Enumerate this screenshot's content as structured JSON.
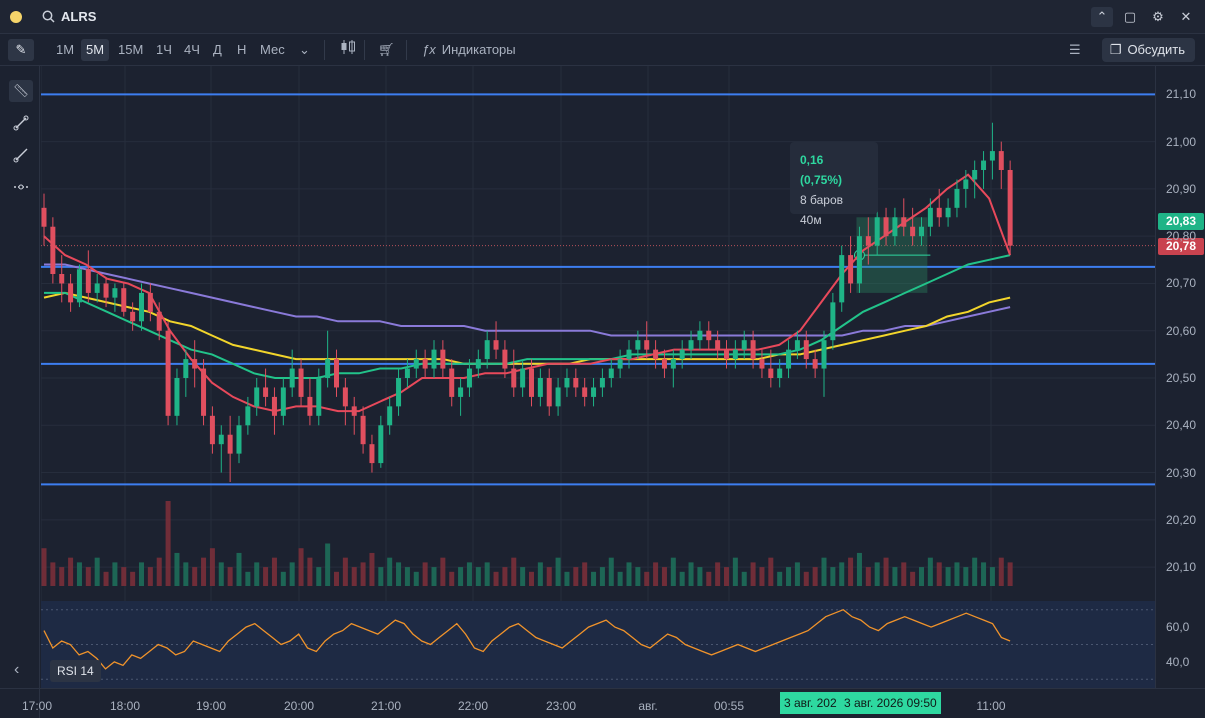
{
  "ticker": "ALRS",
  "timeframes": [
    "1М",
    "5М",
    "15М",
    "1Ч",
    "4Ч",
    "Д",
    "Н",
    "Мес"
  ],
  "active_timeframe": "5М",
  "indicators_label": "Индикаторы",
  "discuss_label": "Обсудить",
  "price_labels": [
    "21,10",
    "21,00",
    "20,90",
    "20,80",
    "20,70",
    "20,60",
    "20,50",
    "20,40",
    "20,30",
    "20,20",
    "20,10"
  ],
  "last_price_badge": "20,83",
  "current_price_badge": "20,78",
  "rsi_labels": [
    "60,0",
    "40,0"
  ],
  "rsi_name": "RSI 14",
  "time_labels": [
    "17:00",
    "18:00",
    "19:00",
    "20:00",
    "21:00",
    "22:00",
    "23:00",
    "авг.",
    "00:55",
    "11:00"
  ],
  "cursor_time_1": "3 авг. 202",
  "cursor_time_2": "3 авг. 2026 09:50",
  "measure": {
    "change": "0,16 (0,75%)",
    "bars": "8 баров",
    "duration": "40м",
    "marker": "B"
  },
  "colors": {
    "bg": "#1c2230",
    "up": "#1fb487",
    "down": "#e04f5f",
    "level": "#3d7ef0",
    "ema_fast": "#e8495b",
    "ema_mid": "#22c38a",
    "ema_slow": "#f2d52b",
    "ema_long": "#8a7ad9",
    "rsi": "#f0932b"
  },
  "chart_data": {
    "type": "candlestick",
    "y_range": [
      20.06,
      21.16
    ],
    "levels": [
      21.1,
      20.735,
      20.53,
      20.275
    ],
    "candles": [
      [
        20.86,
        20.89,
        20.78,
        20.82
      ],
      [
        20.82,
        20.84,
        20.7,
        20.72
      ],
      [
        20.72,
        20.76,
        20.66,
        20.7
      ],
      [
        20.7,
        20.72,
        20.64,
        20.66
      ],
      [
        20.66,
        20.74,
        20.65,
        20.73
      ],
      [
        20.73,
        20.77,
        20.66,
        20.68
      ],
      [
        20.68,
        20.72,
        20.66,
        20.7
      ],
      [
        20.7,
        20.71,
        20.65,
        20.67
      ],
      [
        20.67,
        20.7,
        20.64,
        20.69
      ],
      [
        20.69,
        20.7,
        20.63,
        20.64
      ],
      [
        20.64,
        20.66,
        20.6,
        20.62
      ],
      [
        20.62,
        20.7,
        20.6,
        20.68
      ],
      [
        20.68,
        20.7,
        20.62,
        20.64
      ],
      [
        20.64,
        20.66,
        20.58,
        20.6
      ],
      [
        20.6,
        20.62,
        20.4,
        20.42
      ],
      [
        20.42,
        20.52,
        20.4,
        20.5
      ],
      [
        20.5,
        20.56,
        20.46,
        20.54
      ],
      [
        20.54,
        20.58,
        20.48,
        20.52
      ],
      [
        20.52,
        20.54,
        20.4,
        20.42
      ],
      [
        20.42,
        20.44,
        20.34,
        20.36
      ],
      [
        20.36,
        20.4,
        20.3,
        20.38
      ],
      [
        20.38,
        20.42,
        20.28,
        20.34
      ],
      [
        20.34,
        20.42,
        20.32,
        20.4
      ],
      [
        20.4,
        20.46,
        20.38,
        20.44
      ],
      [
        20.44,
        20.5,
        20.42,
        20.48
      ],
      [
        20.48,
        20.52,
        20.44,
        20.46
      ],
      [
        20.46,
        20.48,
        20.38,
        20.42
      ],
      [
        20.42,
        20.5,
        20.4,
        20.48
      ],
      [
        20.48,
        20.56,
        20.46,
        20.52
      ],
      [
        20.52,
        20.54,
        20.44,
        20.46
      ],
      [
        20.46,
        20.5,
        20.4,
        20.42
      ],
      [
        20.42,
        20.52,
        20.4,
        20.5
      ],
      [
        20.5,
        20.6,
        20.48,
        20.54
      ],
      [
        20.54,
        20.56,
        20.46,
        20.48
      ],
      [
        20.48,
        20.5,
        20.4,
        20.44
      ],
      [
        20.44,
        20.46,
        20.38,
        20.42
      ],
      [
        20.42,
        20.44,
        20.34,
        20.36
      ],
      [
        20.36,
        20.38,
        20.3,
        20.32
      ],
      [
        20.32,
        20.42,
        20.31,
        20.4
      ],
      [
        20.4,
        20.46,
        20.38,
        20.44
      ],
      [
        20.44,
        20.52,
        20.42,
        20.5
      ],
      [
        20.5,
        20.54,
        20.48,
        20.52
      ],
      [
        20.52,
        20.56,
        20.5,
        20.54
      ],
      [
        20.54,
        20.56,
        20.5,
        20.52
      ],
      [
        20.52,
        20.58,
        20.5,
        20.56
      ],
      [
        20.56,
        20.58,
        20.5,
        20.52
      ],
      [
        20.52,
        20.54,
        20.44,
        20.46
      ],
      [
        20.46,
        20.5,
        20.42,
        20.48
      ],
      [
        20.48,
        20.54,
        20.46,
        20.52
      ],
      [
        20.52,
        20.56,
        20.5,
        20.54
      ],
      [
        20.54,
        20.6,
        20.52,
        20.58
      ],
      [
        20.58,
        20.62,
        20.54,
        20.56
      ],
      [
        20.56,
        20.58,
        20.5,
        20.52
      ],
      [
        20.52,
        20.56,
        20.46,
        20.48
      ],
      [
        20.48,
        20.54,
        20.46,
        20.52
      ],
      [
        20.52,
        20.54,
        20.44,
        20.46
      ],
      [
        20.46,
        20.52,
        20.44,
        20.5
      ],
      [
        20.5,
        20.52,
        20.42,
        20.44
      ],
      [
        20.44,
        20.5,
        20.42,
        20.48
      ],
      [
        20.48,
        20.52,
        20.46,
        20.5
      ],
      [
        20.5,
        20.52,
        20.46,
        20.48
      ],
      [
        20.48,
        20.5,
        20.44,
        20.46
      ],
      [
        20.46,
        20.5,
        20.44,
        20.48
      ],
      [
        20.48,
        20.52,
        20.46,
        20.5
      ],
      [
        20.5,
        20.54,
        20.48,
        20.52
      ],
      [
        20.52,
        20.56,
        20.5,
        20.54
      ],
      [
        20.54,
        20.58,
        20.52,
        20.56
      ],
      [
        20.56,
        20.6,
        20.54,
        20.58
      ],
      [
        20.58,
        20.62,
        20.54,
        20.56
      ],
      [
        20.56,
        20.58,
        20.52,
        20.54
      ],
      [
        20.54,
        20.56,
        20.5,
        20.52
      ],
      [
        20.52,
        20.56,
        20.48,
        20.54
      ],
      [
        20.54,
        20.58,
        20.52,
        20.56
      ],
      [
        20.56,
        20.6,
        20.54,
        20.58
      ],
      [
        20.58,
        20.62,
        20.56,
        20.6
      ],
      [
        20.6,
        20.62,
        20.56,
        20.58
      ],
      [
        20.58,
        20.6,
        20.54,
        20.56
      ],
      [
        20.56,
        20.58,
        20.52,
        20.54
      ],
      [
        20.54,
        20.58,
        20.52,
        20.56
      ],
      [
        20.56,
        20.6,
        20.54,
        20.58
      ],
      [
        20.58,
        20.6,
        20.52,
        20.54
      ],
      [
        20.54,
        20.56,
        20.5,
        20.52
      ],
      [
        20.52,
        20.56,
        20.48,
        20.5
      ],
      [
        20.5,
        20.54,
        20.48,
        20.52
      ],
      [
        20.52,
        20.58,
        20.5,
        20.56
      ],
      [
        20.56,
        20.6,
        20.54,
        20.58
      ],
      [
        20.58,
        20.6,
        20.52,
        20.54
      ],
      [
        20.54,
        20.56,
        20.5,
        20.52
      ],
      [
        20.52,
        20.6,
        20.46,
        20.58
      ],
      [
        20.58,
        20.68,
        20.56,
        20.66
      ],
      [
        20.66,
        20.78,
        20.64,
        20.76
      ],
      [
        20.76,
        20.8,
        20.68,
        20.7
      ],
      [
        20.7,
        20.82,
        20.68,
        20.8
      ],
      [
        20.8,
        20.84,
        20.74,
        20.78
      ],
      [
        20.78,
        20.86,
        20.76,
        20.84
      ],
      [
        20.84,
        20.86,
        20.78,
        20.8
      ],
      [
        20.8,
        20.86,
        20.78,
        20.84
      ],
      [
        20.84,
        20.88,
        20.8,
        20.82
      ],
      [
        20.82,
        20.86,
        20.78,
        20.8
      ],
      [
        20.8,
        20.84,
        20.78,
        20.82
      ],
      [
        20.82,
        20.88,
        20.8,
        20.86
      ],
      [
        20.86,
        20.9,
        20.82,
        20.84
      ],
      [
        20.84,
        20.88,
        20.82,
        20.86
      ],
      [
        20.86,
        20.92,
        20.84,
        20.9
      ],
      [
        20.9,
        20.94,
        20.86,
        20.92
      ],
      [
        20.92,
        20.96,
        20.88,
        20.94
      ],
      [
        20.94,
        20.98,
        20.9,
        20.96
      ],
      [
        20.96,
        21.04,
        20.92,
        20.98
      ],
      [
        20.98,
        21.0,
        20.9,
        20.94
      ],
      [
        20.94,
        20.96,
        20.76,
        20.78
      ]
    ],
    "ema_fast": [
      20.8,
      20.76,
      20.74,
      20.71,
      20.7,
      20.68,
      20.6,
      20.54,
      20.49,
      20.46,
      20.44,
      20.43,
      20.44,
      20.44,
      20.43,
      20.43,
      20.45,
      20.47,
      20.5,
      20.5,
      20.5,
      20.51,
      20.51,
      20.52,
      20.53,
      20.53,
      20.53,
      20.54,
      20.54,
      20.55,
      20.56,
      20.56,
      20.56,
      20.56,
      20.56,
      20.57,
      20.6,
      20.66,
      20.72,
      20.77,
      20.8,
      20.83,
      20.86,
      20.9,
      20.93,
      20.88,
      20.76
    ],
    "ema_mid": [
      20.68,
      20.68,
      20.66,
      20.64,
      20.62,
      20.6,
      20.58,
      20.56,
      20.55,
      20.53,
      20.51,
      20.5,
      20.5,
      20.5,
      20.51,
      20.51,
      20.52,
      20.52,
      20.53,
      20.53,
      20.53,
      20.53,
      20.53,
      20.54,
      20.54,
      20.54,
      20.54,
      20.54,
      20.55,
      20.55,
      20.55,
      20.55,
      20.55,
      20.55,
      20.55,
      20.55,
      20.56,
      20.58,
      20.61,
      20.64,
      20.66,
      20.68,
      20.7,
      20.72,
      20.74,
      20.75,
      20.76
    ],
    "ema_slow": [
      20.67,
      20.68,
      20.67,
      20.66,
      20.65,
      20.64,
      20.62,
      20.61,
      20.59,
      20.57,
      20.56,
      20.55,
      20.54,
      20.54,
      20.54,
      20.54,
      20.54,
      20.54,
      20.54,
      20.54,
      20.53,
      20.53,
      20.53,
      20.53,
      20.53,
      20.53,
      20.54,
      20.54,
      20.54,
      20.54,
      20.54,
      20.54,
      20.54,
      20.54,
      20.54,
      20.55,
      20.55,
      20.56,
      20.57,
      20.58,
      20.59,
      20.6,
      20.61,
      20.63,
      20.64,
      20.66,
      20.67
    ],
    "ema_long": [
      20.74,
      20.74,
      20.73,
      20.72,
      20.71,
      20.7,
      20.69,
      20.68,
      20.67,
      20.66,
      20.65,
      20.64,
      20.63,
      20.63,
      20.62,
      20.62,
      20.62,
      20.61,
      20.61,
      20.61,
      20.61,
      20.6,
      20.6,
      20.6,
      20.6,
      20.6,
      20.6,
      20.59,
      20.59,
      20.59,
      20.59,
      20.59,
      20.59,
      20.59,
      20.59,
      20.59,
      20.59,
      20.59,
      20.59,
      20.6,
      20.6,
      20.61,
      20.61,
      20.62,
      20.63,
      20.64,
      20.65
    ],
    "volume": [
      8,
      5,
      4,
      6,
      5,
      4,
      6,
      3,
      5,
      4,
      3,
      5,
      4,
      6,
      18,
      7,
      5,
      4,
      6,
      8,
      5,
      4,
      7,
      3,
      5,
      4,
      6,
      3,
      5,
      8,
      6,
      4,
      9,
      3,
      6,
      4,
      5,
      7,
      4,
      6,
      5,
      4,
      3,
      5,
      4,
      6,
      3,
      4,
      5,
      4,
      5,
      3,
      4,
      6,
      4,
      3,
      5,
      4,
      6,
      3,
      4,
      5,
      3,
      4,
      6,
      3,
      5,
      4,
      3,
      5,
      4,
      6,
      3,
      5,
      4,
      3,
      5,
      4,
      6,
      3,
      5,
      4,
      6,
      3,
      4,
      5,
      3,
      4,
      6,
      4,
      5,
      6,
      7,
      4,
      5,
      6,
      4,
      5,
      3,
      4,
      6,
      5,
      4,
      5,
      4,
      6,
      5,
      4,
      6,
      5
    ],
    "rsi": [
      58,
      48,
      52,
      50,
      44,
      46,
      42,
      36,
      40,
      38,
      44,
      42,
      46,
      50,
      48,
      44,
      46,
      52,
      50,
      48,
      46,
      52,
      56,
      60,
      62,
      58,
      54,
      50,
      52,
      56,
      48,
      46,
      52,
      56,
      58,
      62,
      60,
      58,
      56,
      60,
      64,
      62,
      56,
      52,
      50,
      54,
      58,
      62,
      56,
      48,
      46,
      52,
      56,
      60,
      62,
      58,
      54,
      52,
      50,
      48,
      52,
      56,
      60,
      62,
      64,
      60,
      58,
      54,
      50,
      48,
      52,
      56,
      54,
      50,
      48,
      46,
      44,
      46,
      48,
      50,
      48,
      46,
      48,
      50,
      52,
      54,
      56,
      58,
      62,
      66,
      68,
      70,
      66,
      64,
      60,
      58,
      62,
      64,
      66,
      64,
      62,
      60,
      62,
      64,
      66,
      68,
      66,
      64,
      62,
      54,
      52
    ]
  }
}
